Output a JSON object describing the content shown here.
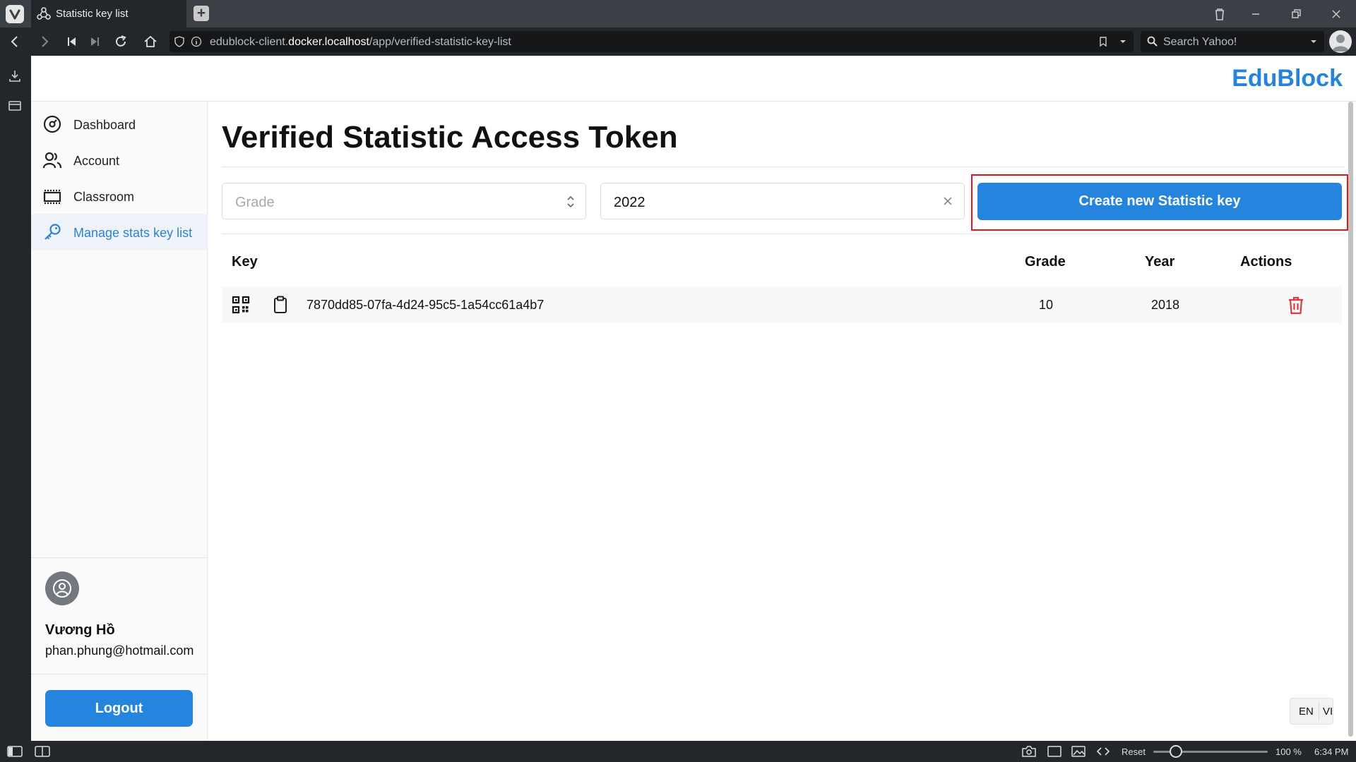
{
  "browser": {
    "tab_title": "Statistic key list",
    "url_prefix": "edublock-client.",
    "url_domain": "docker.localhost",
    "url_path": "/app/verified-statistic-key-list",
    "search_placeholder": "Search Yahoo!"
  },
  "app": {
    "brand": "EduBlock"
  },
  "sidebar": {
    "items": [
      {
        "label": "Dashboard",
        "icon": "dashboard-icon"
      },
      {
        "label": "Account",
        "icon": "users-icon"
      },
      {
        "label": "Classroom",
        "icon": "classroom-icon"
      },
      {
        "label": "Manage stats key list",
        "icon": "key-icon",
        "active": true
      }
    ],
    "user": {
      "name": "Vương Hồ",
      "email": "phan.phung@hotmail.com"
    },
    "logout_label": "Logout"
  },
  "main": {
    "title": "Verified Statistic Access Token",
    "filters": {
      "grade_placeholder": "Grade",
      "year_value": "2022"
    },
    "create_button_label": "Create new Statistic key",
    "table": {
      "headers": {
        "key": "Key",
        "grade": "Grade",
        "year": "Year",
        "actions": "Actions"
      },
      "rows": [
        {
          "key": "7870dd85-07fa-4d24-95c5-1a54cc61a4b7",
          "grade": "10",
          "year": "2018"
        }
      ]
    }
  },
  "language": {
    "en": "EN",
    "vi": "VI"
  },
  "status_bar": {
    "reset_label": "Reset",
    "zoom": "100 %",
    "time": "6:34 PM"
  },
  "colors": {
    "accent": "#2585de",
    "brand": "#2783d8",
    "danger": "#e0393e",
    "highlight": "#e3151d"
  }
}
